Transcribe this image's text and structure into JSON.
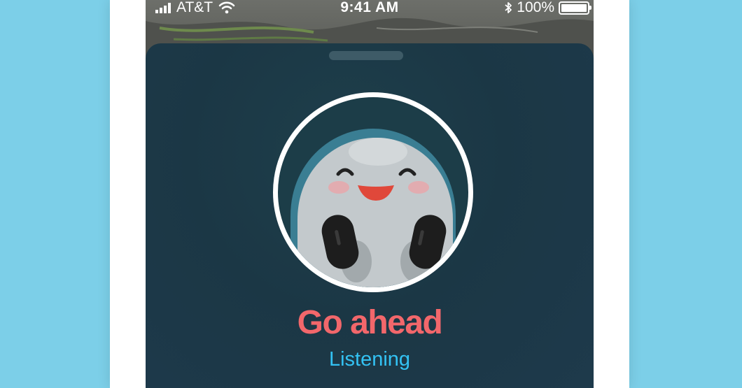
{
  "status_bar": {
    "carrier": "AT&T",
    "time": "9:41 AM",
    "battery_percent": "100%",
    "battery_level": 1.0,
    "icons": [
      "signal-icon",
      "wifi-icon",
      "bluetooth-icon",
      "battery-icon"
    ]
  },
  "voice_panel": {
    "title": "Go ahead",
    "subtitle": "Listening"
  },
  "colors": {
    "background": "#7ccfe8",
    "panel": "#1b3745",
    "title": "#f2676b",
    "subtitle": "#33c2f3"
  }
}
